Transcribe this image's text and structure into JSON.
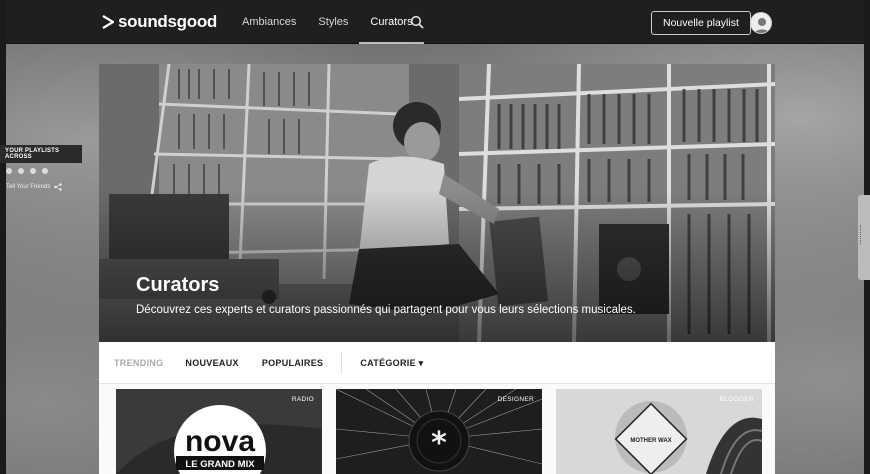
{
  "header": {
    "logo_text": "soundsgood",
    "nav": [
      "Ambiances",
      "Styles",
      "Curators"
    ],
    "active_nav": "Curators",
    "new_playlist_label": "Nouvelle playlist"
  },
  "side_promo": {
    "title": "YOUR PLAYLISTS ACROSS",
    "share_label": "Tell Your Friends"
  },
  "hero": {
    "title": "Curators",
    "subtitle": "Découvrez ces experts et curators passionnés qui partagent pour vous leurs sélections musicales."
  },
  "filters": {
    "trending": "TRENDING",
    "nouveaux": "NOUVEAUX",
    "populaires": "POPULAIRES",
    "categorie": "CATÉGORIE ▾"
  },
  "cards": [
    {
      "tag": "RADIO",
      "logo_top": "nova",
      "logo_bottom": "LE GRAND MIX"
    },
    {
      "tag": "DESIGNER"
    },
    {
      "tag": "BLOGGER",
      "badge": "MOTHER WAX"
    }
  ],
  "colors": {
    "topbar": "#1f1f1f",
    "hero_overlay_text": "#ffffff",
    "filter_text": "#222222",
    "filter_muted": "#aaaaaa"
  }
}
